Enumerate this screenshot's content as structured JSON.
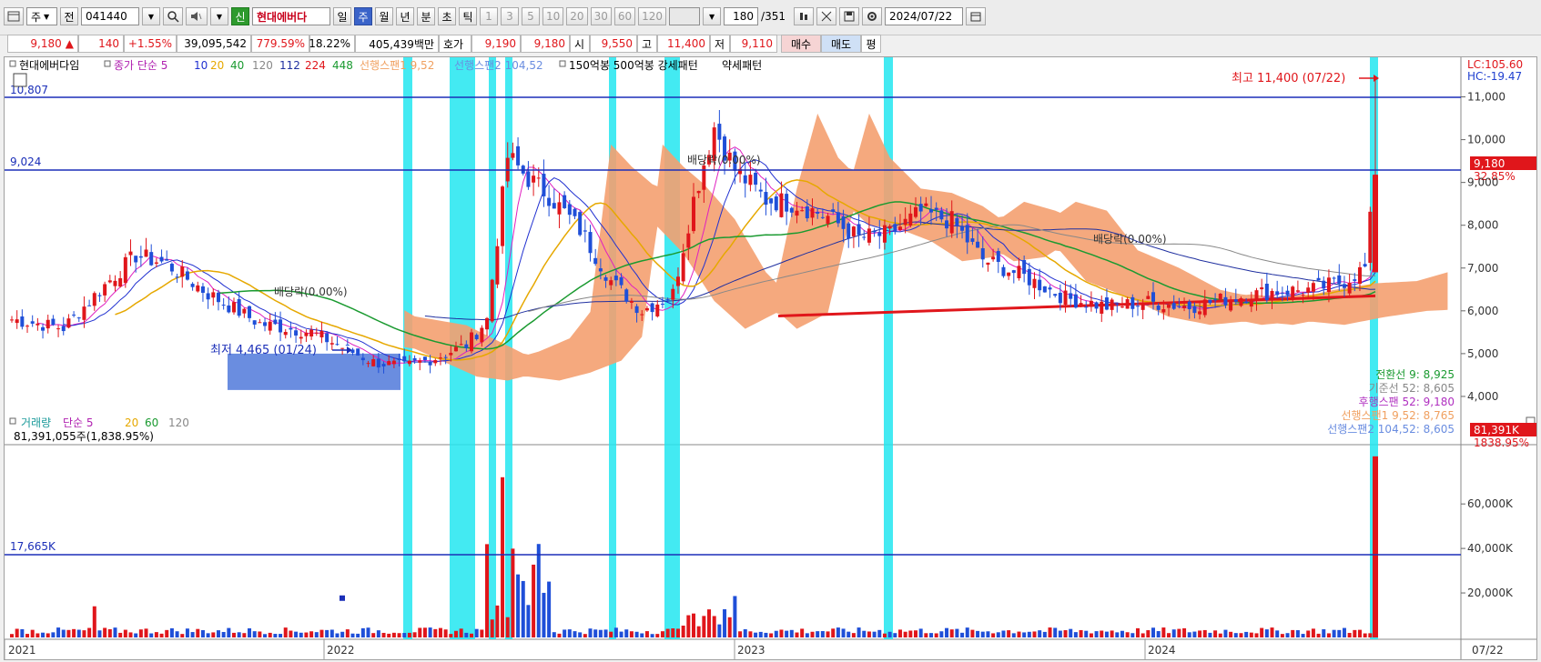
{
  "toolbar": {
    "chart_icon": "chart-icon",
    "period_select": "주",
    "prev_label": "전",
    "code": "041440",
    "new_badge": "신",
    "stock_name": "현대에버다",
    "periods": [
      "일",
      "주",
      "월",
      "년",
      "분",
      "초",
      "틱"
    ],
    "selected_period": "주",
    "minute_values": [
      "1",
      "3",
      "5",
      "10",
      "20",
      "30",
      "60",
      "120"
    ],
    "count_value": "180",
    "count_total": "/351",
    "date": "2024/07/22"
  },
  "quote": {
    "price": "9,180",
    "change_arrow": "▲",
    "change": "140",
    "change_pct": "+1.55%",
    "volume": "39,095,542",
    "volume_pct": "779.59%",
    "turnover": "18.22%",
    "amount": "405,439백만",
    "hoga_label": "호가",
    "ask": "9,190",
    "bid": "9,180",
    "open_label": "시",
    "open": "9,550",
    "high_label": "고",
    "high": "11,400",
    "low_label": "저",
    "low": "9,110",
    "buy_label": "매수",
    "sell_label": "매도",
    "eval_label": "평"
  },
  "price_legend": {
    "name": "현대에버다임",
    "close_label": "종가 단순 5",
    "ma": [
      "10",
      "20",
      "40",
      "120",
      "112",
      "224",
      "448"
    ],
    "span1": "선행스팬1 9,52",
    "span2": "선행스팬2 104,52",
    "patterns": "150억봉 500억봉 강세패턴",
    "weak": "약세패턴",
    "colors": {
      "ma5": "#e020c0",
      "ma10": "#2030d0",
      "ma20": "#e6a800",
      "ma40": "#1a9a30",
      "ma120": "#888888",
      "ma112": "#2030a0",
      "ma224": "#e0161b",
      "ma448": "#1a9a30",
      "span1": "#f4a070",
      "span2": "#6a8de0"
    }
  },
  "price_panel": {
    "lc": "LC:105.60",
    "hc": "HC:-19.47",
    "hline_top": "10,807",
    "hline_mid": "9,024",
    "high_note": "최고 11,400 (07/22)",
    "low_note": "최저 4,465 (01/24)",
    "dividend_1": "배당락(0.00%)",
    "dividend_2": "배당락(0.00%)",
    "dividend_3": "배당락(0.00%)",
    "current_tag": "9,180",
    "current_pct": "32.85%",
    "indicators": [
      {
        "label": "전환선 9: 8,925",
        "color": "#1a9a30"
      },
      {
        "label": "기준선 52: 8,605",
        "color": "#888888"
      },
      {
        "label": "후행스팬 52: 9,180",
        "color": "#b030c0"
      },
      {
        "label": "선행스팬1 9,52: 8,765",
        "color": "#f0a060"
      },
      {
        "label": "선행스팬2 104,52: 8,605",
        "color": "#6a8de0"
      }
    ],
    "y_ticks": [
      "11,000",
      "10,000",
      "9,000",
      "8,000",
      "7,000",
      "6,000",
      "5,000",
      "4,000"
    ]
  },
  "volume_panel": {
    "legend_label": "거래량",
    "ma_label": "단순 5",
    "ma": [
      "20",
      "60",
      "120"
    ],
    "value": "81,391,055주(1,838.95%)",
    "hline": "17,665K",
    "current_tag": "81,391K",
    "current_pct": "1838.95%",
    "y_ticks": [
      "60,000K",
      "40,000K",
      "20,000K"
    ]
  },
  "x_axis": {
    "labels": [
      "2021",
      "2022",
      "2023",
      "2024",
      "07/22"
    ]
  },
  "chart_data": {
    "type": "candlestick",
    "ylim": [
      3000,
      11500
    ],
    "hlines": [
      10807,
      9024
    ],
    "close_series_approx": {
      "x": [
        "2021-01",
        "2021-04",
        "2021-07",
        "2021-10",
        "2022-01",
        "2022-03",
        "2022-04",
        "2022-06",
        "2022-09",
        "2022-11",
        "2023-01",
        "2023-04",
        "2023-06",
        "2023-09",
        "2024-01",
        "2024-04",
        "2024-07"
      ],
      "values": [
        5800,
        7300,
        6300,
        5700,
        4700,
        5100,
        9600,
        8700,
        6000,
        10300,
        8400,
        7800,
        8300,
        6200,
        6100,
        6500,
        9180
      ]
    },
    "volume_ylim": [
      0,
      85000
    ],
    "volume_hline": 17665,
    "latest": {
      "close": 9180,
      "high": 11400,
      "low": 9110,
      "volume_k": 81391
    }
  }
}
